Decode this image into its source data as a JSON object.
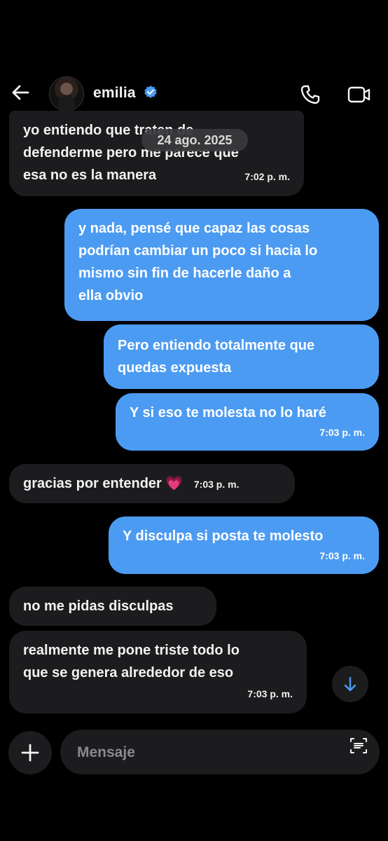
{
  "header": {
    "contact_name": "emilia",
    "verified": true,
    "icons": [
      "back-arrow-icon",
      "avatar",
      "verified-badge-icon",
      "phone-icon",
      "video-camera-icon"
    ]
  },
  "date_separator": "24 ago. 2025",
  "messages": [
    {
      "direction": "in",
      "lines": [
        "yo entiendo que traten de",
        "defenderme pero me parece que",
        "esa no es la manera"
      ],
      "time": "7:02 p. m."
    },
    {
      "direction": "out",
      "lines": [
        "y nada, pensé que capaz las cosas",
        "podrían cambiar un poco si hacia lo",
        "mismo sin fin de hacerle daño a",
        "ella obvio"
      ],
      "time": ""
    },
    {
      "direction": "out",
      "lines": [
        "Pero entiendo totalmente que",
        "quedas expuesta"
      ],
      "time": ""
    },
    {
      "direction": "out",
      "lines": [
        "Y si eso te molesta no lo haré"
      ],
      "time": "7:03 p. m."
    },
    {
      "direction": "in",
      "lines": [
        "gracias por entender 💗"
      ],
      "time": "7:03 p. m."
    },
    {
      "direction": "out",
      "lines": [
        "Y disculpa si posta te molesto"
      ],
      "time": "7:03 p. m."
    },
    {
      "direction": "in",
      "lines": [
        "no me pidas disculpas"
      ],
      "time": ""
    },
    {
      "direction": "in",
      "lines": [
        "realmente me pone triste todo lo",
        "que se genera alrededor de eso"
      ],
      "time": "7:03 p. m."
    }
  ],
  "composer": {
    "placeholder": "Mensaje",
    "value": ""
  },
  "colors": {
    "background": "#000000",
    "incoming_bubble": "#1c1c1e",
    "outgoing_bubble": "#4c9bf2",
    "verified": "#4c9bf2"
  }
}
